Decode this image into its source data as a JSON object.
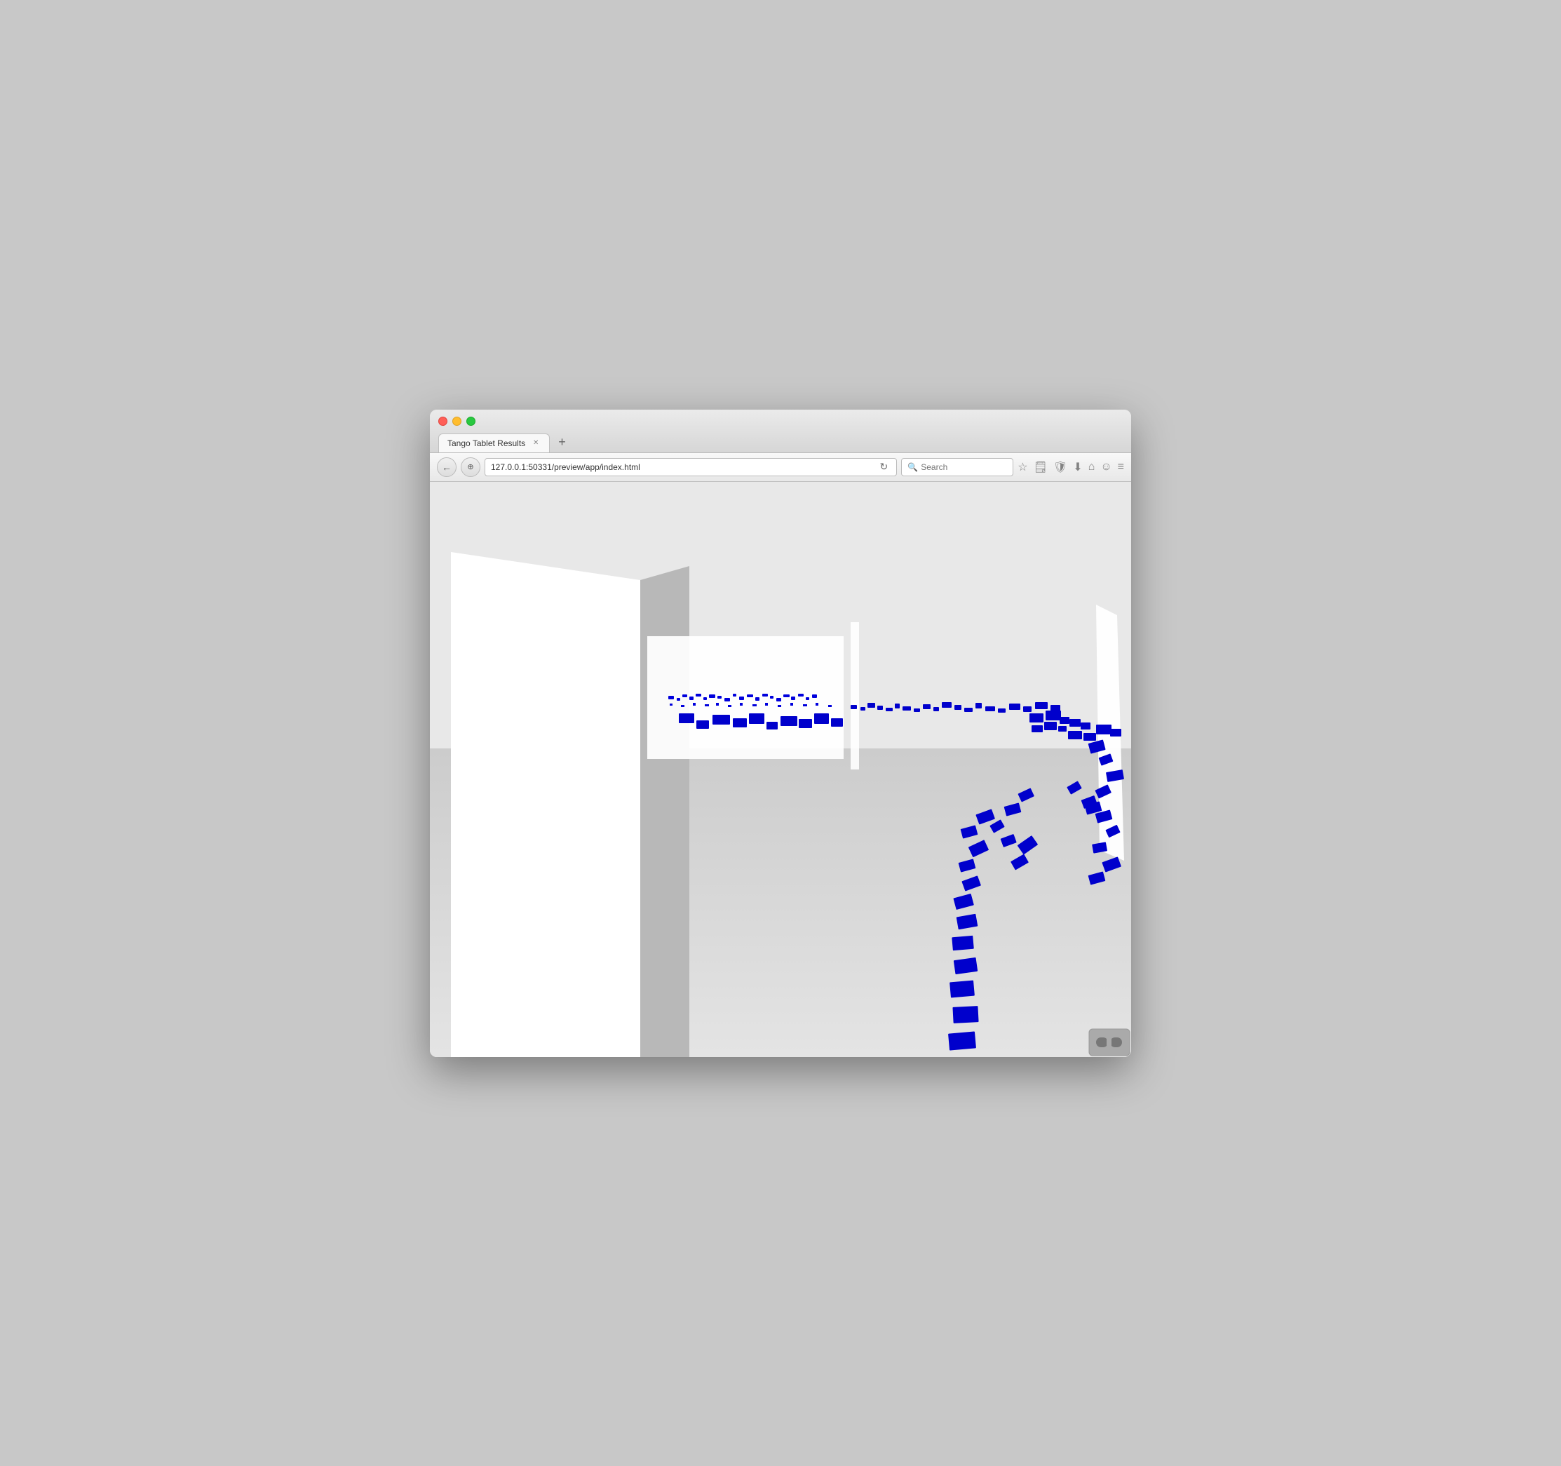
{
  "browser": {
    "tab_title": "Tango Tablet Results",
    "url": "127.0.0.1:50331/preview/app/index.html",
    "search_placeholder": "Search",
    "new_tab_label": "+"
  },
  "nav": {
    "back_icon": "←",
    "history_icon": "⊕",
    "reload_icon": "↻"
  },
  "toolbar_icons": {
    "bookmark": "☆",
    "reader": "🗒",
    "shield": "🛡",
    "download": "↓",
    "home": "⌂",
    "smiley": "☺",
    "menu": "≡"
  },
  "vr": {
    "icon": "⬛⬛"
  },
  "scene": {
    "background_color": "#e8e8e8",
    "point_color": "#0000cc"
  }
}
